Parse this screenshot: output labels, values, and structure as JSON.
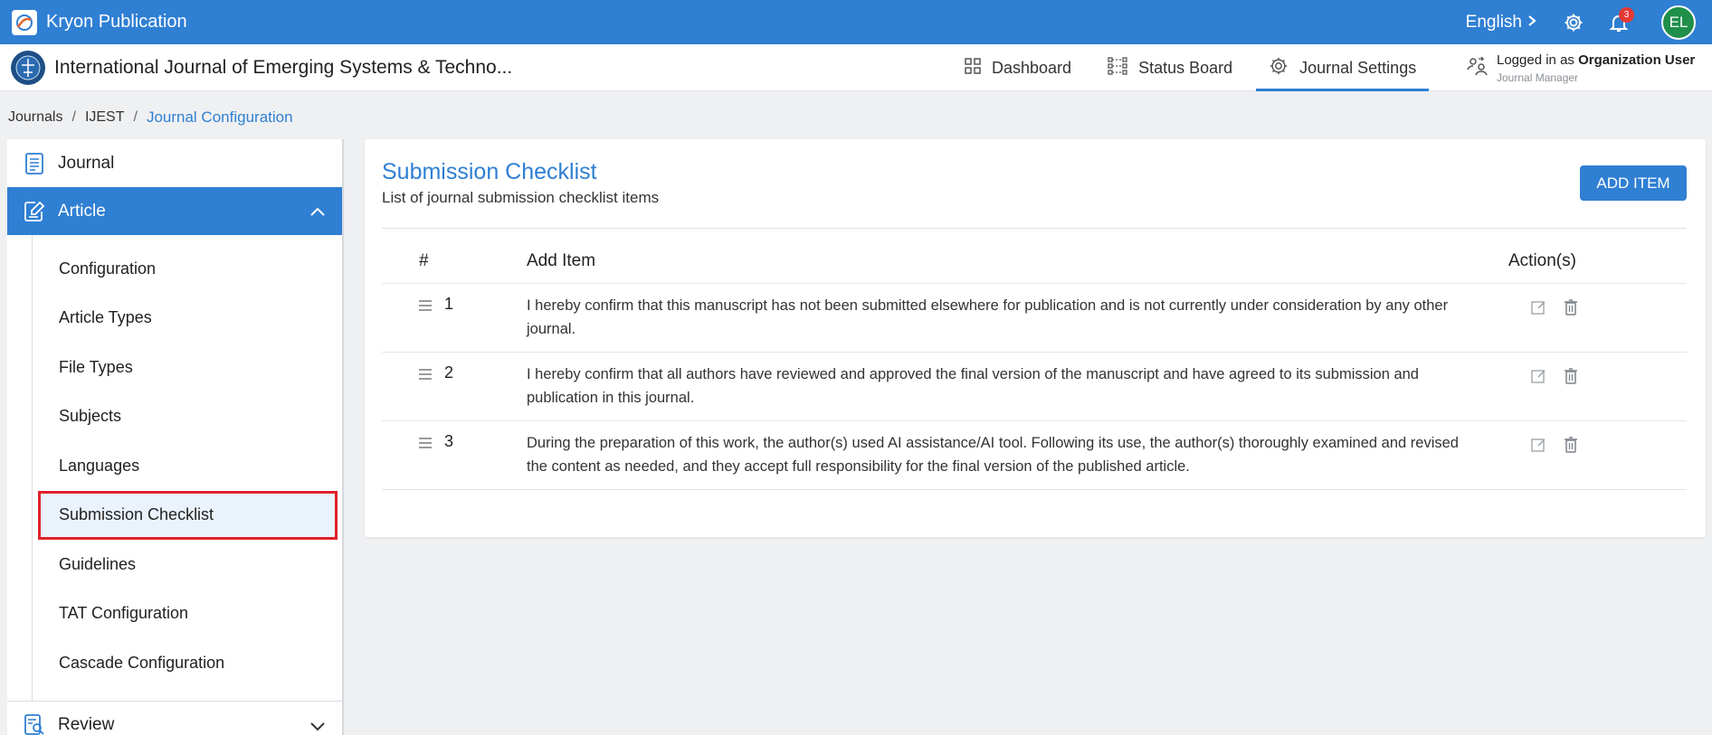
{
  "topbar": {
    "brand": "Kryon Publication",
    "language": "English",
    "notifications_count": "3",
    "avatar_initials": "EL"
  },
  "subbar": {
    "journal_title": "International Journal of Emerging Systems & Techno...",
    "nav": [
      {
        "label": "Dashboard",
        "icon": "grid-icon"
      },
      {
        "label": "Status Board",
        "icon": "status-board-icon"
      },
      {
        "label": "Journal Settings",
        "icon": "gear-icon",
        "active": true
      }
    ],
    "user": {
      "prefix": "Logged in as",
      "name": "Organization User",
      "role": "Journal Manager"
    }
  },
  "breadcrumb": [
    "Journals",
    "IJEST",
    "Journal Configuration"
  ],
  "sidebar": {
    "journal": "Journal",
    "article": "Article",
    "article_items": [
      "Configuration",
      "Article Types",
      "File Types",
      "Subjects",
      "Languages",
      "Submission Checklist",
      "Guidelines",
      "TAT Configuration",
      "Cascade Configuration"
    ],
    "active_item": "Submission Checklist",
    "review": "Review"
  },
  "main": {
    "title": "Submission Checklist",
    "subtitle": "List of journal submission checklist items",
    "add_button": "ADD ITEM",
    "columns": [
      "#",
      "Add Item",
      "Action(s)"
    ],
    "rows": [
      {
        "num": "1",
        "text": "I hereby confirm that this manuscript has not been submitted elsewhere for publication and is not currently under consideration by any other journal."
      },
      {
        "num": "2",
        "text": "I hereby confirm that all authors have reviewed and approved the final version of the manuscript and have agreed to its submission and publication in this journal."
      },
      {
        "num": "3",
        "text": "During the preparation of this work, the author(s) used AI assistance/AI tool. Following its use, the author(s) thoroughly examined and revised the content as needed, and they accept full responsibility for the final version of the published article."
      }
    ]
  },
  "colors": {
    "primary": "#2f7fd3",
    "highlight_border": "#e0222b",
    "avatar_bg": "#1f8f4a",
    "badge": "#e53935"
  }
}
